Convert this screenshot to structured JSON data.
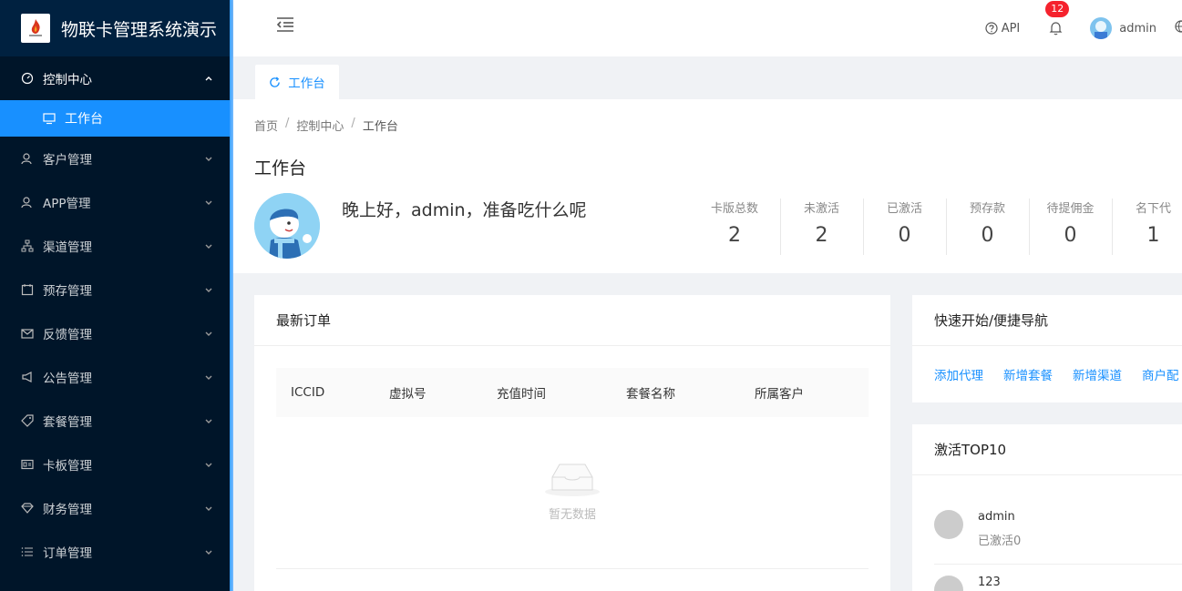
{
  "app": {
    "title": "物联卡管理系统演示"
  },
  "sidebar": {
    "items": [
      {
        "label": "控制中心",
        "icon": "dashboard-icon",
        "open": true
      },
      {
        "label": "客户管理",
        "icon": "user-icon"
      },
      {
        "label": "APP管理",
        "icon": "user-icon"
      },
      {
        "label": "渠道管理",
        "icon": "cluster-icon"
      },
      {
        "label": "预存管理",
        "icon": "calendar-icon"
      },
      {
        "label": "反馈管理",
        "icon": "mail-icon"
      },
      {
        "label": "公告管理",
        "icon": "notification-icon"
      },
      {
        "label": "套餐管理",
        "icon": "tag-icon"
      },
      {
        "label": "卡板管理",
        "icon": "idcard-icon"
      },
      {
        "label": "财务管理",
        "icon": "diamond-icon"
      },
      {
        "label": "订单管理",
        "icon": "list-icon"
      }
    ],
    "subitem": {
      "label": "工作台",
      "icon": "desktop-icon"
    }
  },
  "header": {
    "api_label": "API",
    "notification_count": "12",
    "username": "admin"
  },
  "tabs": [
    {
      "label": "工作台",
      "active": true
    }
  ],
  "breadcrumb": [
    "首页",
    "控制中心",
    "工作台"
  ],
  "page": {
    "title": "工作台",
    "greeting": "晚上好，admin，准备吃什么呢"
  },
  "stats": [
    {
      "label": "卡版总数",
      "value": "2"
    },
    {
      "label": "未激活",
      "value": "2"
    },
    {
      "label": "已激活",
      "value": "0"
    },
    {
      "label": "预存款",
      "value": "0"
    },
    {
      "label": "待提佣金",
      "value": "0"
    },
    {
      "label": "名下代",
      "value": "1"
    }
  ],
  "orders": {
    "title": "最新订单",
    "columns": [
      "ICCID",
      "虚拟号",
      "充值时间",
      "套餐名称",
      "所属客户"
    ],
    "empty_text": "暂无数据"
  },
  "quick_nav": {
    "title": "快速开始/便捷导航",
    "links": [
      "添加代理",
      "新增套餐",
      "新增渠道",
      "商户配"
    ]
  },
  "top10": {
    "title": "激活TOP10",
    "items": [
      {
        "name": "admin",
        "sub": "已激活0"
      },
      {
        "name": "123",
        "sub": ""
      }
    ]
  },
  "colors": {
    "primary": "#1890ff",
    "sidebar": "#001529",
    "badge": "#f5222d"
  }
}
